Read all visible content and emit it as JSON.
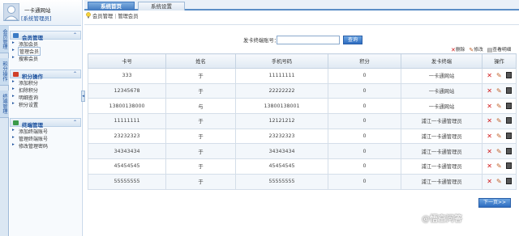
{
  "header": {
    "title": "一卡通网站",
    "role": "[系统管理员]"
  },
  "side_tabs": [
    "会员管理",
    "积分操作",
    "终端管理"
  ],
  "sidebar": {
    "groups": [
      {
        "title": "会员管理",
        "items": [
          "添加会员",
          "管理会员",
          "搜索会员"
        ],
        "selected": 1
      },
      {
        "title": "积分操作",
        "items": [
          "添加积分",
          "扣除积分",
          "明细查询",
          "积分设置"
        ]
      },
      {
        "title": "终端管理",
        "items": [
          "添加终端账号",
          "管理终端账号",
          "修改管理密码"
        ]
      }
    ]
  },
  "tabs": [
    "系统首页",
    "系统设置"
  ],
  "breadcrumb": [
    "会员管理",
    "管理会员"
  ],
  "search": {
    "label": "发卡终端账号：",
    "value": "",
    "button": "查询"
  },
  "toolbar": {
    "delete": "删除",
    "edit": "修改",
    "view": "查看明细"
  },
  "table": {
    "headers": [
      "卡号",
      "姓名",
      "手机号码",
      "积分",
      "发卡终端",
      "操作"
    ],
    "rows": [
      [
        "333",
        "于",
        "11111111",
        "0",
        "一卡通网站"
      ],
      [
        "12345678",
        "于",
        "22222222",
        "0",
        "一卡通网站"
      ],
      [
        "13800138000",
        "与",
        "13800138001",
        "0",
        "一卡通网站"
      ],
      [
        "11111111",
        "于",
        "12121212",
        "0",
        "浦江一卡通管理员"
      ],
      [
        "23232323",
        "于",
        "23232323",
        "0",
        "浦江一卡通管理员"
      ],
      [
        "34343434",
        "于",
        "34343434",
        "0",
        "浦江一卡通管理员"
      ],
      [
        "45454545",
        "于",
        "45454545",
        "0",
        "浦江一卡通管理员"
      ],
      [
        "55555555",
        "于",
        "55555555",
        "0",
        "浦江一卡通管理员"
      ]
    ]
  },
  "pagination": {
    "next": "下一页>>"
  },
  "watermark": "@悟空问答",
  "colors": {
    "accent": "#3f78bf",
    "delete": "#d0181a",
    "edit": "#c0622a"
  }
}
